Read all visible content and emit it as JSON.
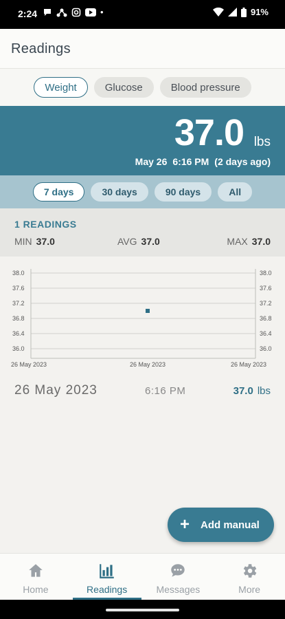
{
  "status_bar": {
    "time": "2:24",
    "battery": "91%"
  },
  "app": {
    "title": "Readings"
  },
  "type_tabs": [
    {
      "label": "Weight",
      "active": true
    },
    {
      "label": "Glucose",
      "active": false
    },
    {
      "label": "Blood pressure",
      "active": false
    }
  ],
  "latest": {
    "value": "37.0",
    "unit": "lbs",
    "date": "May 26",
    "time": "6:16 PM",
    "relative": "(2 days ago)"
  },
  "range_tabs": [
    {
      "label": "7 days",
      "active": true
    },
    {
      "label": "30 days",
      "active": false
    },
    {
      "label": "90 days",
      "active": false
    },
    {
      "label": "All",
      "active": false
    }
  ],
  "stats": {
    "count_label": "1 READINGS",
    "min_label": "MIN",
    "min_value": "37.0",
    "avg_label": "AVG",
    "avg_value": "37.0",
    "max_label": "MAX",
    "max_value": "37.0"
  },
  "chart_data": {
    "type": "scatter",
    "title": "",
    "xlabel": "",
    "ylabel": "",
    "x_tick_labels": [
      "26 May 2023",
      "26 May 2023",
      "26 May 2023"
    ],
    "y_ticks": [
      "38.0",
      "37.6",
      "37.2",
      "36.8",
      "36.4",
      "36.0"
    ],
    "ylim": [
      36.0,
      38.0
    ],
    "grid": true,
    "points": [
      {
        "x": "26 May 2023 6:16 PM",
        "y": 37.0
      }
    ],
    "color": "#2f6f86"
  },
  "reading_list": [
    {
      "date": "26 May 2023",
      "time": "6:16 PM",
      "value": "37.0",
      "unit": "lbs"
    }
  ],
  "fab": {
    "label": "Add manual",
    "icon": "plus-icon"
  },
  "bottom_nav": [
    {
      "label": "Home",
      "icon": "home-icon",
      "active": false
    },
    {
      "label": "Readings",
      "icon": "bar-chart-icon",
      "active": true
    },
    {
      "label": "Messages",
      "icon": "chat-bubble-icon",
      "active": false
    },
    {
      "label": "More",
      "icon": "gear-icon",
      "active": false
    }
  ],
  "colors": {
    "primary": "#397b92",
    "accent_dark": "#2f6f86",
    "range_band": "#a6c4cf",
    "background": "#f3f2ef"
  }
}
